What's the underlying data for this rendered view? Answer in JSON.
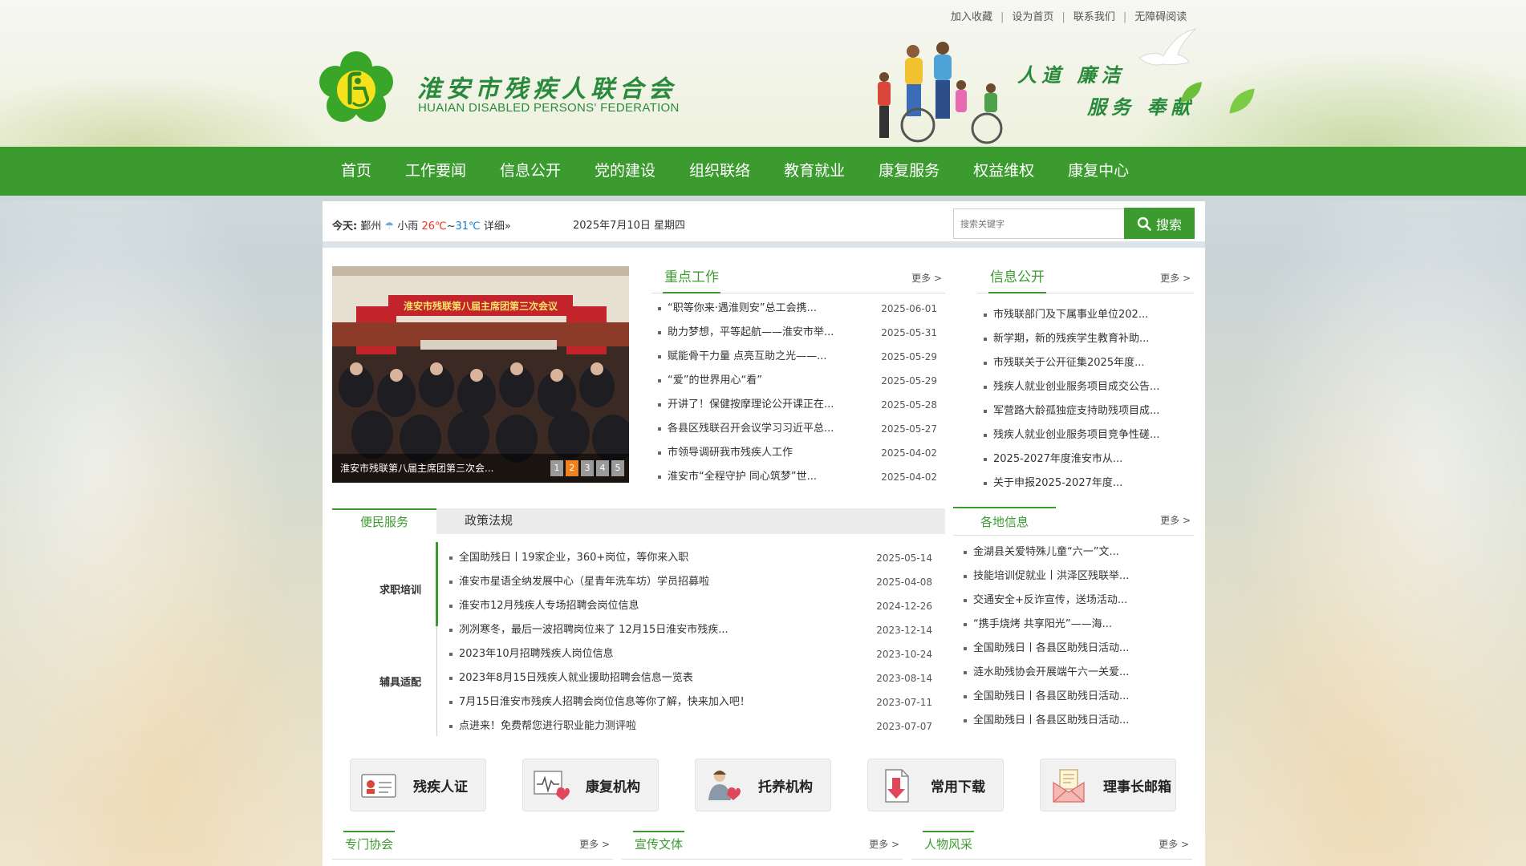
{
  "header": {
    "top_links": [
      "加入收藏",
      "设为首页",
      "联系我们",
      "无障碍阅读"
    ],
    "site_title": "淮安市残疾人联合会",
    "site_subtitle": "HUAIAN DISABLED PERSONS'  FEDERATION",
    "slogan_line1": "人道  廉洁",
    "slogan_line2": "服务  奉献"
  },
  "nav": {
    "items": [
      "首页",
      "工作要闻",
      "信息公开",
      "党的建设",
      "组织联络",
      "教育就业",
      "康复服务",
      "权益维权",
      "康复中心"
    ]
  },
  "weather": {
    "today_label": "今天:",
    "city": "鄞州",
    "condition": "小雨",
    "low": "26℃",
    "tilde": "~",
    "high": "31℃",
    "detail": "详细»",
    "date": "2025年7月10日 星期四"
  },
  "search": {
    "placeholder": "搜索关键字",
    "button_label": "搜索"
  },
  "slideshow": {
    "caption": "淮安市残联第八届主席团第三次会...",
    "banner_text": "淮安市残联第八届主席团第三次会议",
    "pages": [
      "1",
      "2",
      "3",
      "4",
      "5"
    ],
    "active_page": 2
  },
  "key_work": {
    "title": "重点工作",
    "more": "更多 >",
    "items": [
      {
        "text": "“职等你来·遇淮则安”总工会携...",
        "date": "2025-06-01"
      },
      {
        "text": "助力梦想，平等起航——淮安市举...",
        "date": "2025-05-31"
      },
      {
        "text": "赋能骨干力量 点亮互助之光——...",
        "date": "2025-05-29"
      },
      {
        "text": "“爱”的世界用心“看”",
        "date": "2025-05-29"
      },
      {
        "text": "开讲了！保健按摩理论公开课正在...",
        "date": "2025-05-28"
      },
      {
        "text": "各县区残联召开会议学习习近平总...",
        "date": "2025-05-27"
      },
      {
        "text": "市领导调研我市残疾人工作",
        "date": "2025-04-02"
      },
      {
        "text": "淮安市“全程守护 同心筑梦”世...",
        "date": "2025-04-02"
      }
    ]
  },
  "info_public": {
    "title": "信息公开",
    "more": "更多 >",
    "items": [
      "市残联部门及下属事业单位202...",
      "新学期，新的残疾学生教育补助...",
      "市残联关于公开征集2025年度...",
      "残疾人就业创业服务项目成交公告...",
      "军营路大龄孤独症支持助残项目成...",
      "残疾人就业创业服务项目竞争性磋...",
      "2025-2027年度淮安市从...",
      "关于申报2025-2027年度..."
    ]
  },
  "service_tabs": {
    "tabs": [
      "便民服务",
      "政策法规"
    ],
    "side_labels": [
      "求职培训",
      "辅具适配"
    ],
    "items": [
      {
        "text": "全国助残日丨19家企业，360+岗位，等你来入职",
        "date": "2025-05-14"
      },
      {
        "text": "淮安市星语全纳发展中心（星青年洗车坊）学员招募啦",
        "date": "2025-04-08"
      },
      {
        "text": "淮安市12月残疾人专场招聘会岗位信息",
        "date": "2024-12-26"
      },
      {
        "text": "冽冽寒冬，最后一波招聘岗位来了 12月15日淮安市残疾...",
        "date": "2023-12-14"
      },
      {
        "text": "2023年10月招聘残疾人岗位信息",
        "date": "2023-10-24"
      },
      {
        "text": "2023年8月15日残疾人就业援助招聘会信息一览表",
        "date": "2023-08-14"
      },
      {
        "text": "7月15日淮安市残疾人招聘会岗位信息等你了解，快来加入吧！",
        "date": "2023-07-11"
      },
      {
        "text": "点进来！免费帮您进行职业能力测评啦",
        "date": "2023-07-07"
      }
    ]
  },
  "local_info": {
    "title": "各地信息",
    "more": "更多 >",
    "items": [
      "金湖县关爱特殊儿童“六一”文...",
      "技能培训促就业丨洪泽区残联举...",
      "交通安全+反诈宣传，送场活动...",
      "“携手烧烤 共享阳光”——海...",
      "全国助残日丨各县区助残日活动...",
      "涟水助残协会开展端午六一关爱...",
      "全国助残日丨各县区助残日活动...",
      "全国助残日丨各县区助残日活动..."
    ]
  },
  "quick_links": [
    {
      "label": "残疾人证",
      "icon": "id-card-icon"
    },
    {
      "label": "康复机构",
      "icon": "heart-monitor-icon"
    },
    {
      "label": "托养机构",
      "icon": "caregiver-icon"
    },
    {
      "label": "常用下载",
      "icon": "download-icon"
    },
    {
      "label": "理事长邮箱",
      "icon": "mailbox-icon"
    }
  ],
  "bottom_sections": [
    {
      "title": "专门协会",
      "more": "更多 >"
    },
    {
      "title": "宣传文体",
      "more": "更多 >"
    },
    {
      "title": "人物风采",
      "more": "更多 >"
    }
  ],
  "colors": {
    "brand_green": "#3c9b2f",
    "accent_orange": "#f0821e",
    "temp_high_red": "#e32222"
  }
}
